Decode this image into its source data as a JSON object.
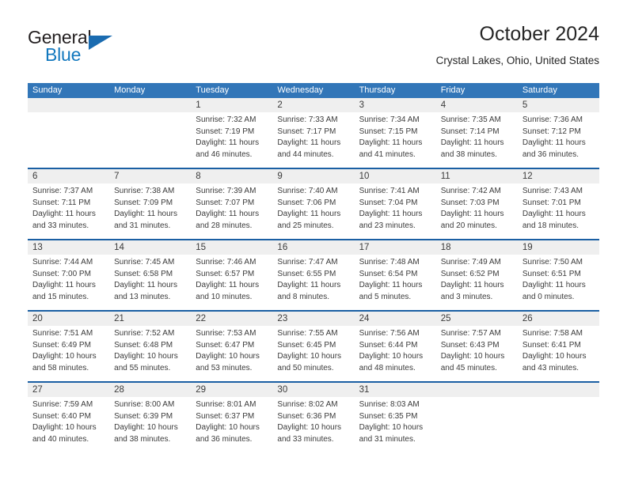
{
  "brand": {
    "name_part1": "General",
    "name_part2": "Blue",
    "triangle_color": "#1a6bb0",
    "blue_color": "#1278be"
  },
  "header": {
    "title": "October 2024",
    "subtitle": "Crystal Lakes, Ohio, United States"
  },
  "theme": {
    "header_blue": "#3276b8",
    "divider_blue": "#1a5fa3",
    "band_gray": "#efefef",
    "text": "#3b3b3b"
  },
  "calendar": {
    "weekdays": [
      "Sunday",
      "Monday",
      "Tuesday",
      "Wednesday",
      "Thursday",
      "Friday",
      "Saturday"
    ],
    "weeks": [
      [
        {
          "day": "",
          "sunrise": "",
          "sunset": "",
          "daylight1": "",
          "daylight2": ""
        },
        {
          "day": "",
          "sunrise": "",
          "sunset": "",
          "daylight1": "",
          "daylight2": ""
        },
        {
          "day": "1",
          "sunrise": "Sunrise: 7:32 AM",
          "sunset": "Sunset: 7:19 PM",
          "daylight1": "Daylight: 11 hours",
          "daylight2": "and 46 minutes."
        },
        {
          "day": "2",
          "sunrise": "Sunrise: 7:33 AM",
          "sunset": "Sunset: 7:17 PM",
          "daylight1": "Daylight: 11 hours",
          "daylight2": "and 44 minutes."
        },
        {
          "day": "3",
          "sunrise": "Sunrise: 7:34 AM",
          "sunset": "Sunset: 7:15 PM",
          "daylight1": "Daylight: 11 hours",
          "daylight2": "and 41 minutes."
        },
        {
          "day": "4",
          "sunrise": "Sunrise: 7:35 AM",
          "sunset": "Sunset: 7:14 PM",
          "daylight1": "Daylight: 11 hours",
          "daylight2": "and 38 minutes."
        },
        {
          "day": "5",
          "sunrise": "Sunrise: 7:36 AM",
          "sunset": "Sunset: 7:12 PM",
          "daylight1": "Daylight: 11 hours",
          "daylight2": "and 36 minutes."
        }
      ],
      [
        {
          "day": "6",
          "sunrise": "Sunrise: 7:37 AM",
          "sunset": "Sunset: 7:11 PM",
          "daylight1": "Daylight: 11 hours",
          "daylight2": "and 33 minutes."
        },
        {
          "day": "7",
          "sunrise": "Sunrise: 7:38 AM",
          "sunset": "Sunset: 7:09 PM",
          "daylight1": "Daylight: 11 hours",
          "daylight2": "and 31 minutes."
        },
        {
          "day": "8",
          "sunrise": "Sunrise: 7:39 AM",
          "sunset": "Sunset: 7:07 PM",
          "daylight1": "Daylight: 11 hours",
          "daylight2": "and 28 minutes."
        },
        {
          "day": "9",
          "sunrise": "Sunrise: 7:40 AM",
          "sunset": "Sunset: 7:06 PM",
          "daylight1": "Daylight: 11 hours",
          "daylight2": "and 25 minutes."
        },
        {
          "day": "10",
          "sunrise": "Sunrise: 7:41 AM",
          "sunset": "Sunset: 7:04 PM",
          "daylight1": "Daylight: 11 hours",
          "daylight2": "and 23 minutes."
        },
        {
          "day": "11",
          "sunrise": "Sunrise: 7:42 AM",
          "sunset": "Sunset: 7:03 PM",
          "daylight1": "Daylight: 11 hours",
          "daylight2": "and 20 minutes."
        },
        {
          "day": "12",
          "sunrise": "Sunrise: 7:43 AM",
          "sunset": "Sunset: 7:01 PM",
          "daylight1": "Daylight: 11 hours",
          "daylight2": "and 18 minutes."
        }
      ],
      [
        {
          "day": "13",
          "sunrise": "Sunrise: 7:44 AM",
          "sunset": "Sunset: 7:00 PM",
          "daylight1": "Daylight: 11 hours",
          "daylight2": "and 15 minutes."
        },
        {
          "day": "14",
          "sunrise": "Sunrise: 7:45 AM",
          "sunset": "Sunset: 6:58 PM",
          "daylight1": "Daylight: 11 hours",
          "daylight2": "and 13 minutes."
        },
        {
          "day": "15",
          "sunrise": "Sunrise: 7:46 AM",
          "sunset": "Sunset: 6:57 PM",
          "daylight1": "Daylight: 11 hours",
          "daylight2": "and 10 minutes."
        },
        {
          "day": "16",
          "sunrise": "Sunrise: 7:47 AM",
          "sunset": "Sunset: 6:55 PM",
          "daylight1": "Daylight: 11 hours",
          "daylight2": "and 8 minutes."
        },
        {
          "day": "17",
          "sunrise": "Sunrise: 7:48 AM",
          "sunset": "Sunset: 6:54 PM",
          "daylight1": "Daylight: 11 hours",
          "daylight2": "and 5 minutes."
        },
        {
          "day": "18",
          "sunrise": "Sunrise: 7:49 AM",
          "sunset": "Sunset: 6:52 PM",
          "daylight1": "Daylight: 11 hours",
          "daylight2": "and 3 minutes."
        },
        {
          "day": "19",
          "sunrise": "Sunrise: 7:50 AM",
          "sunset": "Sunset: 6:51 PM",
          "daylight1": "Daylight: 11 hours",
          "daylight2": "and 0 minutes."
        }
      ],
      [
        {
          "day": "20",
          "sunrise": "Sunrise: 7:51 AM",
          "sunset": "Sunset: 6:49 PM",
          "daylight1": "Daylight: 10 hours",
          "daylight2": "and 58 minutes."
        },
        {
          "day": "21",
          "sunrise": "Sunrise: 7:52 AM",
          "sunset": "Sunset: 6:48 PM",
          "daylight1": "Daylight: 10 hours",
          "daylight2": "and 55 minutes."
        },
        {
          "day": "22",
          "sunrise": "Sunrise: 7:53 AM",
          "sunset": "Sunset: 6:47 PM",
          "daylight1": "Daylight: 10 hours",
          "daylight2": "and 53 minutes."
        },
        {
          "day": "23",
          "sunrise": "Sunrise: 7:55 AM",
          "sunset": "Sunset: 6:45 PM",
          "daylight1": "Daylight: 10 hours",
          "daylight2": "and 50 minutes."
        },
        {
          "day": "24",
          "sunrise": "Sunrise: 7:56 AM",
          "sunset": "Sunset: 6:44 PM",
          "daylight1": "Daylight: 10 hours",
          "daylight2": "and 48 minutes."
        },
        {
          "day": "25",
          "sunrise": "Sunrise: 7:57 AM",
          "sunset": "Sunset: 6:43 PM",
          "daylight1": "Daylight: 10 hours",
          "daylight2": "and 45 minutes."
        },
        {
          "day": "26",
          "sunrise": "Sunrise: 7:58 AM",
          "sunset": "Sunset: 6:41 PM",
          "daylight1": "Daylight: 10 hours",
          "daylight2": "and 43 minutes."
        }
      ],
      [
        {
          "day": "27",
          "sunrise": "Sunrise: 7:59 AM",
          "sunset": "Sunset: 6:40 PM",
          "daylight1": "Daylight: 10 hours",
          "daylight2": "and 40 minutes."
        },
        {
          "day": "28",
          "sunrise": "Sunrise: 8:00 AM",
          "sunset": "Sunset: 6:39 PM",
          "daylight1": "Daylight: 10 hours",
          "daylight2": "and 38 minutes."
        },
        {
          "day": "29",
          "sunrise": "Sunrise: 8:01 AM",
          "sunset": "Sunset: 6:37 PM",
          "daylight1": "Daylight: 10 hours",
          "daylight2": "and 36 minutes."
        },
        {
          "day": "30",
          "sunrise": "Sunrise: 8:02 AM",
          "sunset": "Sunset: 6:36 PM",
          "daylight1": "Daylight: 10 hours",
          "daylight2": "and 33 minutes."
        },
        {
          "day": "31",
          "sunrise": "Sunrise: 8:03 AM",
          "sunset": "Sunset: 6:35 PM",
          "daylight1": "Daylight: 10 hours",
          "daylight2": "and 31 minutes."
        },
        {
          "day": "",
          "sunrise": "",
          "sunset": "",
          "daylight1": "",
          "daylight2": ""
        },
        {
          "day": "",
          "sunrise": "",
          "sunset": "",
          "daylight1": "",
          "daylight2": ""
        }
      ]
    ]
  }
}
